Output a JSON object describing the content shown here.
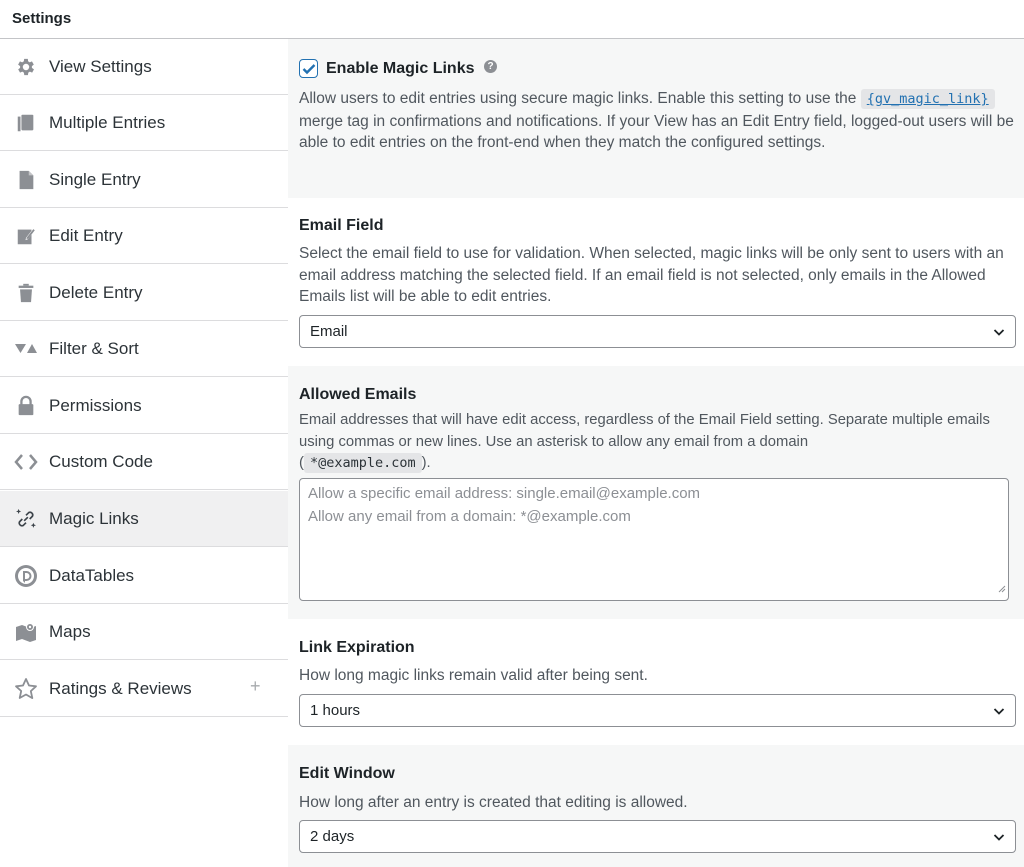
{
  "header": {
    "title": "Settings"
  },
  "sidebar": {
    "items": [
      {
        "label": "View Settings",
        "icon": "gear-icon"
      },
      {
        "label": "Multiple Entries",
        "icon": "copy-icon"
      },
      {
        "label": "Single Entry",
        "icon": "document-icon"
      },
      {
        "label": "Edit Entry",
        "icon": "edit-icon"
      },
      {
        "label": "Delete Entry",
        "icon": "trash-icon"
      },
      {
        "label": "Filter & Sort",
        "icon": "filter-icon"
      },
      {
        "label": "Permissions",
        "icon": "lock-icon"
      },
      {
        "label": "Custom Code",
        "icon": "code-icon"
      },
      {
        "label": "Magic Links",
        "icon": "magic-link-icon"
      },
      {
        "label": "DataTables",
        "icon": "datatables-icon"
      },
      {
        "label": "Maps",
        "icon": "map-icon"
      },
      {
        "label": "Ratings & Reviews",
        "icon": "star-icon",
        "extra": "+"
      }
    ],
    "active_index": 8
  },
  "magic": {
    "enable_label": "Enable Magic Links",
    "enabled": true,
    "help": "?",
    "desc_part1": "Allow users to edit entries using secure magic links. Enable this setting to use the",
    "merge_tag": "{gv_magic_link}",
    "desc_part2": "merge tag in confirmations and notifications. If your View has an Edit Entry field, logged-out users will be able to edit entries on the front-end when they match the configured settings."
  },
  "email_field": {
    "title": "Email Field",
    "desc": "Select the email field to use for validation. When selected, magic links will be only sent to users with an email address matching the selected field. If an email field is not selected, only emails in the Allowed Emails list will be able to edit entries.",
    "value": "Email"
  },
  "allowed_emails": {
    "title": "Allowed Emails",
    "desc_part1": "Email addresses that will have edit access, regardless of the Email Field setting. Separate multiple emails using commas or new lines. Use an asterisk to allow any email from a domain",
    "paren_open": "(",
    "example": "*@example.com",
    "paren_close": ").",
    "placeholder_line1": "Allow a specific email address: single.email@example.com",
    "placeholder_line2": "Allow any email from a domain: *@example.com"
  },
  "link_expiration": {
    "title": "Link Expiration",
    "desc": "How long magic links remain valid after being sent.",
    "value": "1 hours"
  },
  "edit_window": {
    "title": "Edit Window",
    "desc": "How long after an entry is created that editing is allowed.",
    "value": "2 days"
  },
  "colors": {
    "accent": "#2271b1",
    "active_bg": "#f0f0f1",
    "section_gray": "#f6f7f7",
    "icon_gray": "#8c8f94"
  }
}
